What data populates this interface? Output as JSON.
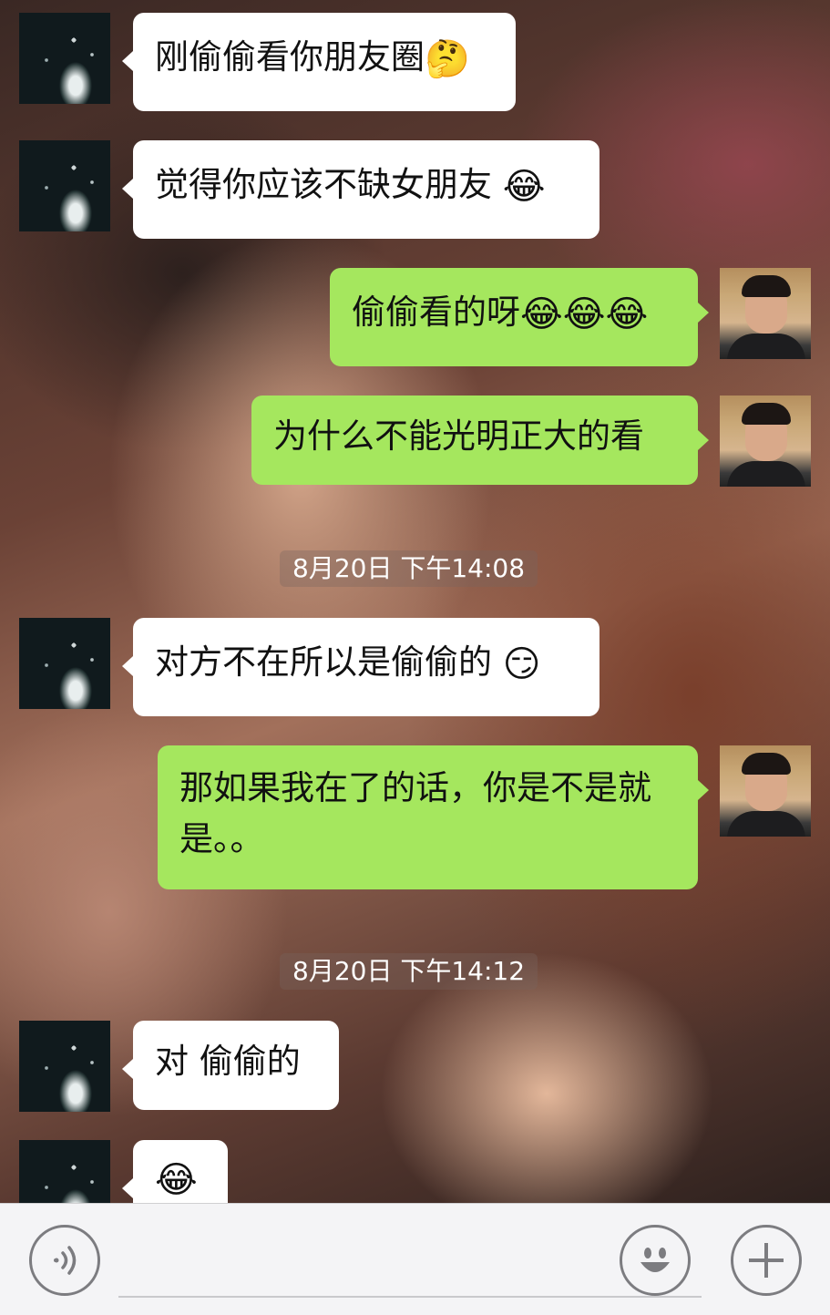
{
  "messages": [
    {
      "id": "m1",
      "side": "in",
      "text": "刚偷偷看你朋友圈",
      "emoji": "🤔"
    },
    {
      "id": "m2",
      "side": "in",
      "text": "觉得你应该不缺女朋友 ",
      "emoji": "😂"
    },
    {
      "id": "m3",
      "side": "out",
      "text": "偷偷看的呀",
      "emoji": "😂😂😂"
    },
    {
      "id": "m4",
      "side": "out",
      "text": "为什么不能光明正大的看",
      "emoji": ""
    },
    {
      "id": "m5",
      "side": "in",
      "text": "对方不在所以是偷偷的 ",
      "emoji": "😏"
    },
    {
      "id": "m6",
      "side": "out",
      "text": "那如果我在了的话，你是不是就是。。",
      "emoji": ""
    },
    {
      "id": "m7",
      "side": "in",
      "text": "对  偷偷的",
      "emoji": ""
    },
    {
      "id": "m8",
      "side": "in",
      "text": "",
      "emoji": "😂"
    }
  ],
  "timestamps": [
    {
      "id": "t1",
      "text": "8月20日 下午14:08"
    },
    {
      "id": "t2",
      "text": "8月20日 下午14:12"
    }
  ],
  "input_bar": {
    "voice_icon": "voice-icon",
    "emoji_icon": "smiley-icon",
    "plus_icon": "plus-icon",
    "text_value": ""
  }
}
